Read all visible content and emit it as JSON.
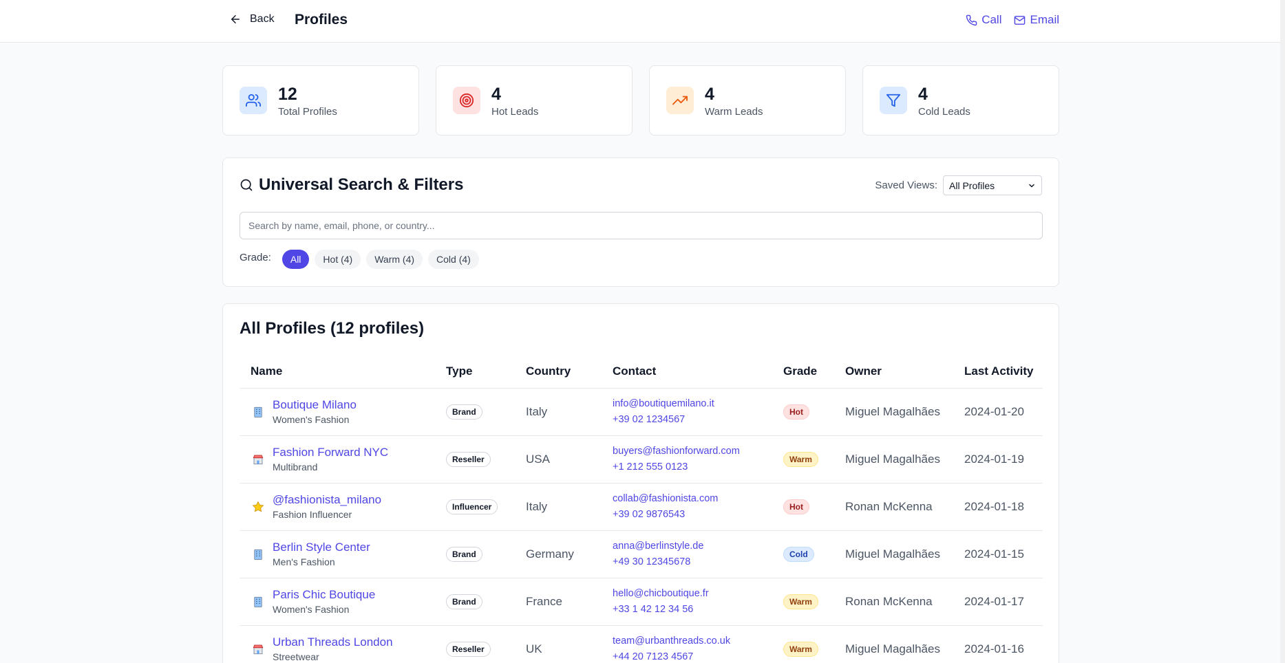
{
  "header": {
    "back_label": "Back",
    "title": "Profiles",
    "call_label": "Call",
    "email_label": "Email"
  },
  "stats": [
    {
      "value": "12",
      "label": "Total Profiles",
      "icon": "users-icon",
      "bg": "#dbeafe",
      "color": "#2563eb"
    },
    {
      "value": "4",
      "label": "Hot Leads",
      "icon": "target-icon",
      "bg": "#fee2e2",
      "color": "#dc2626"
    },
    {
      "value": "4",
      "label": "Warm Leads",
      "icon": "trending-up-icon",
      "bg": "#ffedd5",
      "color": "#ea580c"
    },
    {
      "value": "4",
      "label": "Cold Leads",
      "icon": "filter-icon",
      "bg": "#dbeafe",
      "color": "#2563eb"
    }
  ],
  "search": {
    "title": "Universal Search & Filters",
    "saved_views_label": "Saved Views:",
    "saved_views_value": "All Profiles",
    "placeholder": "Search by name, email, phone, or country...",
    "grade_label": "Grade:",
    "chips": [
      "All",
      "Hot (4)",
      "Warm (4)",
      "Cold (4)"
    ]
  },
  "table": {
    "title": "All Profiles (12 profiles)",
    "columns": [
      "Name",
      "Type",
      "Country",
      "Contact",
      "Grade",
      "Owner",
      "Last Activity"
    ],
    "rows": [
      {
        "icon": "building-icon",
        "name": "Boutique Milano",
        "sub": "Women's Fashion",
        "type": "Brand",
        "country": "Italy",
        "email": "info@boutiquemilano.it",
        "phone": "+39 02 1234567",
        "grade": "Hot",
        "owner": "Miguel Magalhães",
        "last": "2024-01-20"
      },
      {
        "icon": "store-icon",
        "name": "Fashion Forward NYC",
        "sub": "Multibrand",
        "type": "Reseller",
        "country": "USA",
        "email": "buyers@fashionforward.com",
        "phone": "+1 212 555 0123",
        "grade": "Warm",
        "owner": "Miguel Magalhães",
        "last": "2024-01-19"
      },
      {
        "icon": "star-icon",
        "name": "@fashionista_milano",
        "sub": "Fashion Influencer",
        "type": "Influencer",
        "country": "Italy",
        "email": "collab@fashionista.com",
        "phone": "+39 02 9876543",
        "grade": "Hot",
        "owner": "Ronan McKenna",
        "last": "2024-01-18"
      },
      {
        "icon": "building-icon",
        "name": "Berlin Style Center",
        "sub": "Men's Fashion",
        "type": "Brand",
        "country": "Germany",
        "email": "anna@berlinstyle.de",
        "phone": "+49 30 12345678",
        "grade": "Cold",
        "owner": "Miguel Magalhães",
        "last": "2024-01-15"
      },
      {
        "icon": "building-icon",
        "name": "Paris Chic Boutique",
        "sub": "Women's Fashion",
        "type": "Brand",
        "country": "France",
        "email": "hello@chicboutique.fr",
        "phone": "+33 1 42 12 34 56",
        "grade": "Warm",
        "owner": "Ronan McKenna",
        "last": "2024-01-17"
      },
      {
        "icon": "store-icon",
        "name": "Urban Threads London",
        "sub": "Streetwear",
        "type": "Reseller",
        "country": "UK",
        "email": "team@urbanthreads.co.uk",
        "phone": "+44 20 7123 4567",
        "grade": "Warm",
        "owner": "Miguel Magalhães",
        "last": "2024-01-16"
      }
    ]
  },
  "colors": {
    "accent": "#4f46e5",
    "page_bg": "#f8fafc"
  }
}
